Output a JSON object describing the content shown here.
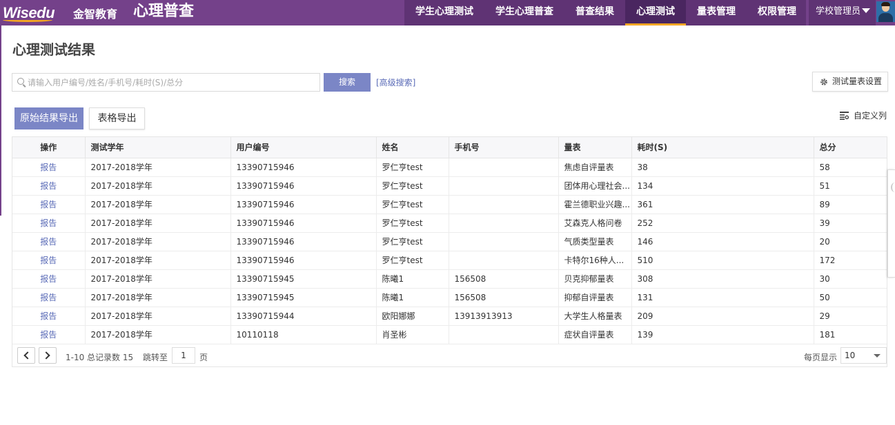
{
  "header": {
    "logo_text": "Wisedu",
    "brand_cn": "金智教育",
    "app_title": "心理普查",
    "nav": [
      {
        "label": "学生心理测试",
        "active": false
      },
      {
        "label": "学生心理普查",
        "active": false
      },
      {
        "label": "普查结果",
        "active": false
      },
      {
        "label": "心理测试",
        "active": true
      },
      {
        "label": "量表管理",
        "active": false
      },
      {
        "label": "权限管理",
        "active": false
      }
    ],
    "user_role": "学校管理员"
  },
  "page": {
    "title": "心理测试结果",
    "search_placeholder": "请输入用户编号/姓名/手机号/耗时(S)/总分",
    "search_value": "",
    "search_button": "搜索",
    "advanced_search": "[高级搜索]",
    "settings_button": "测试量表设置",
    "export_raw": "原始结果导出",
    "export_table": "表格导出",
    "custom_columns": "自定义列"
  },
  "table": {
    "headers": [
      "操作",
      "测试学年",
      "用户编号",
      "姓名",
      "手机号",
      "量表",
      "耗时(S)",
      "总分"
    ],
    "rows": [
      {
        "action": "报告",
        "year": "2017-2018学年",
        "user_id": "13390715946",
        "name": "罗仁亨test",
        "phone": "",
        "scale": "焦虑自评量表",
        "time": "38",
        "score": "58"
      },
      {
        "action": "报告",
        "year": "2017-2018学年",
        "user_id": "13390715946",
        "name": "罗仁亨test",
        "phone": "",
        "scale": "团体用心理社会...",
        "time": "134",
        "score": "51"
      },
      {
        "action": "报告",
        "year": "2017-2018学年",
        "user_id": "13390715946",
        "name": "罗仁亨test",
        "phone": "",
        "scale": "霍兰德职业兴趣...",
        "time": "361",
        "score": "89"
      },
      {
        "action": "报告",
        "year": "2017-2018学年",
        "user_id": "13390715946",
        "name": "罗仁亨test",
        "phone": "",
        "scale": "艾森克人格问卷",
        "time": "252",
        "score": "39"
      },
      {
        "action": "报告",
        "year": "2017-2018学年",
        "user_id": "13390715946",
        "name": "罗仁亨test",
        "phone": "",
        "scale": "气质类型量表",
        "time": "146",
        "score": "20"
      },
      {
        "action": "报告",
        "year": "2017-2018学年",
        "user_id": "13390715946",
        "name": "罗仁亨test",
        "phone": "",
        "scale": "卡特尔16种人...",
        "time": "510",
        "score": "172"
      },
      {
        "action": "报告",
        "year": "2017-2018学年",
        "user_id": "13390715945",
        "name": "陈曦1",
        "phone": "156508",
        "scale": "贝克抑郁量表",
        "time": "308",
        "score": "30"
      },
      {
        "action": "报告",
        "year": "2017-2018学年",
        "user_id": "13390715945",
        "name": "陈曦1",
        "phone": "156508",
        "scale": "抑郁自评量表",
        "time": "131",
        "score": "50"
      },
      {
        "action": "报告",
        "year": "2017-2018学年",
        "user_id": "13390715944",
        "name": "欧阳娜娜",
        "phone": "13913913913",
        "scale": "大学生人格量表",
        "time": "209",
        "score": "29"
      },
      {
        "action": "报告",
        "year": "2017-2018学年",
        "user_id": "10110118",
        "name": "肖圣彬",
        "phone": "",
        "scale": "症状自评量表",
        "time": "139",
        "score": "181"
      }
    ]
  },
  "pager": {
    "range_text": "1-10 总记录数 15",
    "jump_label": "跳转至",
    "page_value": "1",
    "page_suffix": "页",
    "per_page_label": "每页显示",
    "per_page_value": "10"
  },
  "colors": {
    "header_bg": "#74418a",
    "nav_bg": "#5f3374",
    "active_underline": "#f5a623",
    "primary_button": "#7b86c6",
    "link": "#5a6bb7"
  }
}
